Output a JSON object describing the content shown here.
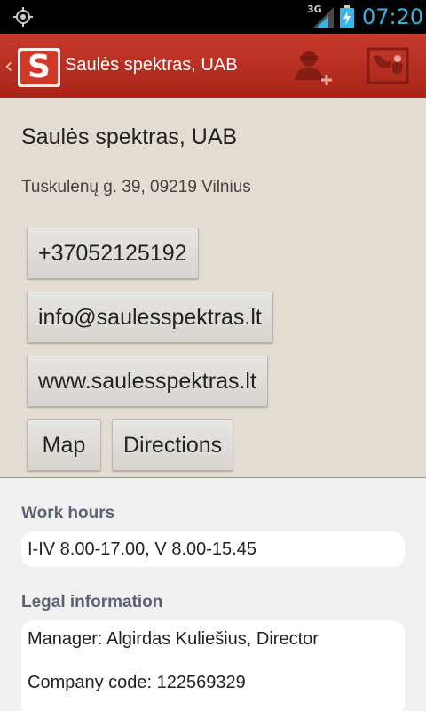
{
  "status_bar": {
    "network": "3G",
    "time": "07:20",
    "icons": [
      "gps-icon",
      "signal-icon",
      "battery-charging-icon"
    ]
  },
  "action_bar": {
    "back_caret": "‹",
    "logo_letter": "S",
    "title": "Saulės spektras, UAB",
    "actions": [
      "add-contact-icon",
      "map-icon"
    ]
  },
  "company": {
    "name": "Saulės spektras, UAB",
    "address": "Tuskulėnų g. 39, 09219 Vilnius",
    "phone": "+37052125192",
    "email": "info@saulesspektras.lt",
    "website": "www.saulesspektras.lt",
    "map_label": "Map",
    "directions_label": "Directions"
  },
  "work_hours": {
    "title": "Work hours",
    "value": "I-IV 8.00-17.00, V 8.00-15.45"
  },
  "legal": {
    "title": "Legal information",
    "manager": "Manager: Algirdas Kuliešius, Director",
    "company_code": "Company code: 122569329"
  },
  "colors": {
    "action_bar": "#b52d20",
    "time": "#33b5e5",
    "section_title": "#5a6173"
  }
}
